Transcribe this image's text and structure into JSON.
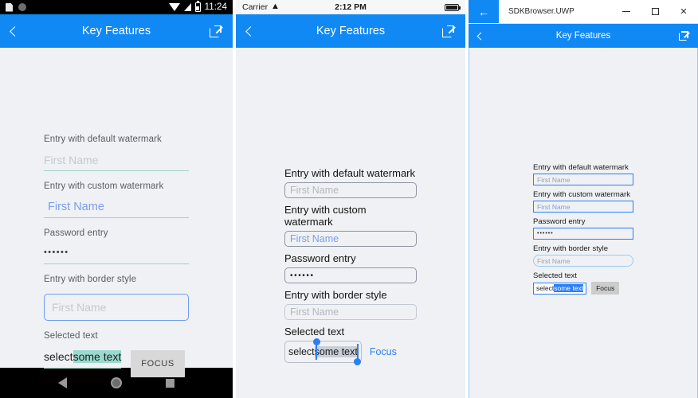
{
  "android": {
    "status": {
      "clock": "11:24",
      "icons": [
        "sim-icon",
        "dot-icon",
        "wifi-icon",
        "signal-icon",
        "battery-icon"
      ]
    },
    "navbar": {
      "title": "Key Features",
      "back_icon": "chevron-left-icon",
      "action_icon": "open-external-icon"
    },
    "form": {
      "label_default": "Entry with default watermark",
      "placeholder_default": "First Name",
      "label_custom": "Entry with custom watermark",
      "placeholder_custom": "First Name",
      "label_password": "Password entry",
      "password_value": "••••••",
      "label_border": "Entry with border style",
      "placeholder_border": "First Name",
      "label_selected": "Selected text",
      "selected_prefix": "select ",
      "selected_highlight": "some text",
      "focus_button": "FOCUS"
    },
    "nav": {
      "back": "back-icon",
      "home": "home-icon",
      "recents": "recents-icon"
    }
  },
  "ios": {
    "status": {
      "carrier": "Carrier",
      "time": "2:12 PM",
      "wifi_icon": "wifi-icon",
      "battery_icon": "battery-icon"
    },
    "navbar": {
      "title": "Key Features",
      "back_icon": "chevron-left-icon",
      "action_icon": "open-external-icon"
    },
    "form": {
      "label_default": "Entry with default watermark",
      "placeholder_default": "First Name",
      "label_custom": "Entry with custom watermark",
      "placeholder_custom": "First Name",
      "label_password": "Password entry",
      "password_value": "••••••",
      "label_border": "Entry with border style",
      "placeholder_border": "First Name",
      "label_selected": "Selected text",
      "selected_prefix": "select",
      "selected_highlight": "some text",
      "focus_link": "Focus"
    }
  },
  "uwp": {
    "titlebar": {
      "app_name": "SDKBrowser.UWP",
      "back_icon": "arrow-left-icon",
      "minimize": "–",
      "maximize": "maximize-icon",
      "close": "✕"
    },
    "navbar": {
      "title": "Key Features",
      "back_icon": "chevron-left-icon",
      "action_icon": "open-external-icon"
    },
    "form": {
      "label_default": "Entry with default watermark",
      "placeholder_default": "First Name",
      "label_custom": "Entry with custom watermark",
      "placeholder_custom": "First Name",
      "label_password": "Password entry",
      "password_value": "••••••",
      "label_border": "Entry with border style",
      "placeholder_border": "First Name",
      "label_selected": "Selected text",
      "selected_prefix": "select ",
      "selected_highlight": "some text",
      "focus_button": "Focus"
    }
  },
  "colors": {
    "accent_blue": "#1089F5",
    "android_underline": "#9FD4C9",
    "android_highlight": "#9AD9CE",
    "custom_watermark": "#7B9EE8",
    "ios_selection": "#C8CDD6",
    "ios_handle": "#2B7FF5",
    "uwp_selection": "#2B7FF5",
    "page_background": "#EFF1F4"
  }
}
